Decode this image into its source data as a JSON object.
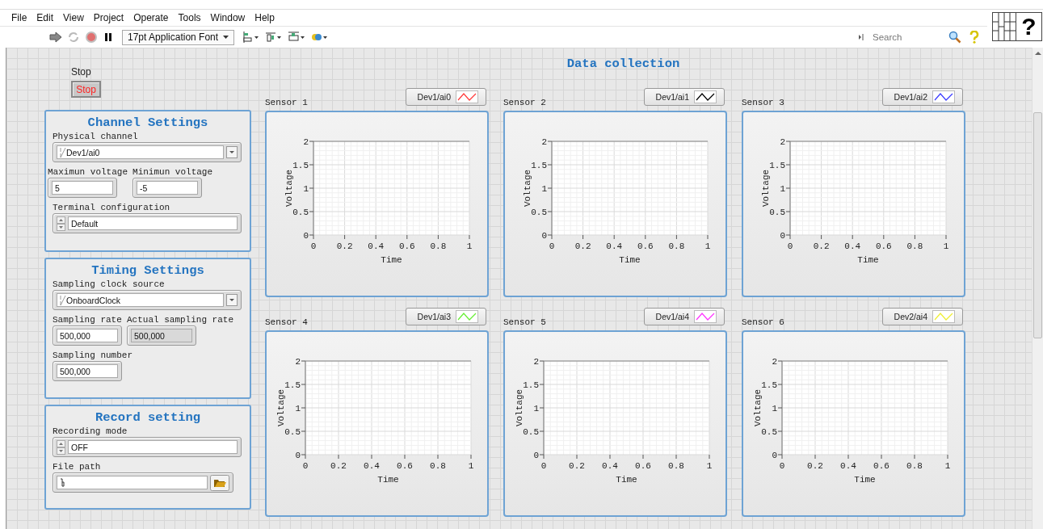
{
  "menu": [
    "File",
    "Edit",
    "View",
    "Project",
    "Operate",
    "Tools",
    "Window",
    "Help"
  ],
  "toolbar": {
    "font": "17pt Application Font",
    "search": {
      "placeholder": "Search"
    }
  },
  "vi_icon": {
    "glyph": "?"
  },
  "stop": {
    "label": "Stop",
    "button": "Stop"
  },
  "title": "Data collection",
  "panels": [
    {
      "title": "Channel Settings",
      "rows": [
        [
          {
            "kind": "io",
            "label": "Physical channel",
            "value": "Dev1/ai0"
          }
        ],
        [
          {
            "kind": "numeric",
            "label": "Maximun voltage",
            "value": "5"
          },
          {
            "kind": "numeric",
            "label": "Minimun voltage",
            "value": "-5"
          }
        ],
        [
          {
            "kind": "ring",
            "label": "Terminal configuration",
            "value": "Default"
          }
        ]
      ]
    },
    {
      "title": "Timing Settings",
      "rows": [
        [
          {
            "kind": "io",
            "label": "Sampling clock source",
            "value": "OnboardClock"
          }
        ],
        [
          {
            "kind": "numeric",
            "label": "Sampling rate",
            "value": "500,000"
          },
          {
            "kind": "indicator",
            "label": "Actual sampling rate",
            "value": "500,000"
          }
        ],
        [
          {
            "kind": "numeric",
            "label": "Sampling number",
            "value": "500,000"
          }
        ]
      ]
    },
    {
      "title": "Record setting",
      "rows": [
        [
          {
            "kind": "ring",
            "label": "Recording mode",
            "value": "OFF"
          }
        ],
        [
          {
            "kind": "path",
            "label": "File path"
          }
        ]
      ]
    }
  ],
  "charts": [
    {
      "label": "Sensor 1",
      "chart_data": {
        "type": "line",
        "grid": true,
        "xlabel": "Time",
        "ylabel": "Voltage",
        "categories": [
          "0",
          "0.2",
          "0.4",
          "0.6",
          "0.8",
          "1"
        ],
        "ylim": [
          0,
          2
        ],
        "yticks": [
          0,
          0.5,
          1,
          1.5,
          2
        ],
        "series": [
          {
            "name": "Dev1/ai0",
            "color": "#ff3b3b",
            "values": [
              null,
              null,
              null,
              null,
              null,
              null
            ]
          }
        ]
      }
    },
    {
      "label": "Sensor 2",
      "chart_data": {
        "type": "line",
        "grid": true,
        "xlabel": "Time",
        "ylabel": "Voltage",
        "categories": [
          "0",
          "0.2",
          "0.4",
          "0.6",
          "0.8",
          "1"
        ],
        "ylim": [
          0,
          2
        ],
        "yticks": [
          0,
          0.5,
          1,
          1.5,
          2
        ],
        "series": [
          {
            "name": "Dev1/ai1",
            "color": "#000000",
            "values": [
              null,
              null,
              null,
              null,
              null,
              null
            ]
          }
        ]
      }
    },
    {
      "label": "Sensor 3",
      "chart_data": {
        "type": "line",
        "grid": true,
        "xlabel": "Time",
        "ylabel": "Voltage",
        "categories": [
          "0",
          "0.2",
          "0.4",
          "0.6",
          "0.8",
          "1"
        ],
        "ylim": [
          0,
          2
        ],
        "yticks": [
          0,
          0.5,
          1,
          1.5,
          2
        ],
        "series": [
          {
            "name": "Dev1/ai2",
            "color": "#3b3bff",
            "values": [
              null,
              null,
              null,
              null,
              null,
              null
            ]
          }
        ]
      }
    },
    {
      "label": "Sensor 4",
      "chart_data": {
        "type": "line",
        "grid": true,
        "xlabel": "Time",
        "ylabel": "Voltage",
        "categories": [
          "0",
          "0.2",
          "0.4",
          "0.6",
          "0.8",
          "1"
        ],
        "ylim": [
          0,
          2
        ],
        "yticks": [
          0,
          0.5,
          1,
          1.5,
          2
        ],
        "series": [
          {
            "name": "Dev1/ai3",
            "color": "#66ee33",
            "values": [
              null,
              null,
              null,
              null,
              null,
              null
            ]
          }
        ]
      }
    },
    {
      "label": "Sensor 5",
      "chart_data": {
        "type": "line",
        "grid": true,
        "xlabel": "Time",
        "ylabel": "Voltage",
        "categories": [
          "0",
          "0.2",
          "0.4",
          "0.6",
          "0.8",
          "1"
        ],
        "ylim": [
          0,
          2
        ],
        "yticks": [
          0,
          0.5,
          1,
          1.5,
          2
        ],
        "series": [
          {
            "name": "Dev1/ai4",
            "color": "#ff33ff",
            "values": [
              null,
              null,
              null,
              null,
              null,
              null
            ]
          }
        ]
      }
    },
    {
      "label": "Sensor 6",
      "chart_data": {
        "type": "line",
        "grid": true,
        "xlabel": "Time",
        "ylabel": "Voltage",
        "categories": [
          "0",
          "0.2",
          "0.4",
          "0.6",
          "0.8",
          "1"
        ],
        "ylim": [
          0,
          2
        ],
        "yticks": [
          0,
          0.5,
          1,
          1.5,
          2
        ],
        "series": [
          {
            "name": "Dev2/ai4",
            "color": "#eeee33",
            "values": [
              null,
              null,
              null,
              null,
              null,
              null
            ]
          }
        ]
      }
    }
  ]
}
